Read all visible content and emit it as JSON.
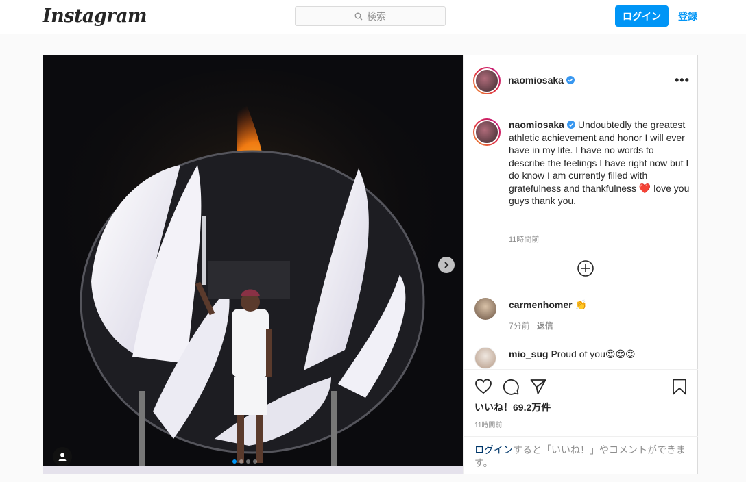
{
  "header": {
    "logo": "Instagram",
    "search_placeholder": "検索",
    "login_button": "ログイン",
    "signup_link": "登録"
  },
  "post": {
    "username": "naomiosaka",
    "caption": "Undoubtedly the greatest athletic achievement and honor I will ever have in my life. I have no words to describe the feelings I have right now but I do know I am currently filled with gratefulness and thankfulness",
    "caption_emoji": "❤️",
    "caption_end": "love you guys thank you.",
    "caption_time": "11時間前",
    "likes": "いいね！69.2万件",
    "time": "11時間前",
    "carousel": {
      "total": 4,
      "active": 1
    }
  },
  "comments": [
    {
      "username": "carmenhomer",
      "text": "👏",
      "time": "7分前",
      "reply": "返信"
    },
    {
      "username": "mio_sug",
      "text": "Proud of you😍😍😍"
    }
  ],
  "login_prompt": {
    "link": "ログイン",
    "rest": "すると「いいね！」やコメントができます。"
  },
  "colors": {
    "accent": "#0095f6",
    "heart": "#ed4956"
  }
}
